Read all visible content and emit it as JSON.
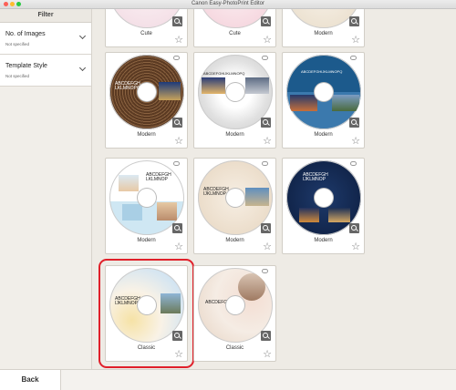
{
  "window": {
    "title": "Canon Easy-PhotoPrint Editor"
  },
  "sidebar": {
    "header": "Filter",
    "filters": [
      {
        "title": "No. of Images",
        "value": "Not specified"
      },
      {
        "title": "Template Style",
        "value": "Not specified"
      }
    ]
  },
  "templates": [
    {
      "label": "Cute"
    },
    {
      "label": "Cute"
    },
    {
      "label": "Modern"
    },
    {
      "label": "Modern",
      "disc_text": "ABCDEFGH\nLKLMNOPQ"
    },
    {
      "label": "Modern",
      "disc_text": "ABCDEFGHIJKLMNOPQ"
    },
    {
      "label": "Modern",
      "disc_text": "ABCDEFGHIJKLMNOPQ"
    },
    {
      "label": "Modern",
      "disc_text": "ABCDEFGH\nLKLMNOP"
    },
    {
      "label": "Modern",
      "disc_text": "ABCDEFGH\nIJKLMNOP"
    },
    {
      "label": "Modern",
      "disc_text": "ABCDEFGH\nIJKLMNOP"
    },
    {
      "label": "Classic",
      "disc_text": "ABCDEFGH\nIJKLMNOP"
    },
    {
      "label": "Classic",
      "disc_text": "ABCDEFGH"
    }
  ],
  "footer": {
    "back_label": "Back"
  },
  "colors": {
    "selection": "#e0202a"
  }
}
